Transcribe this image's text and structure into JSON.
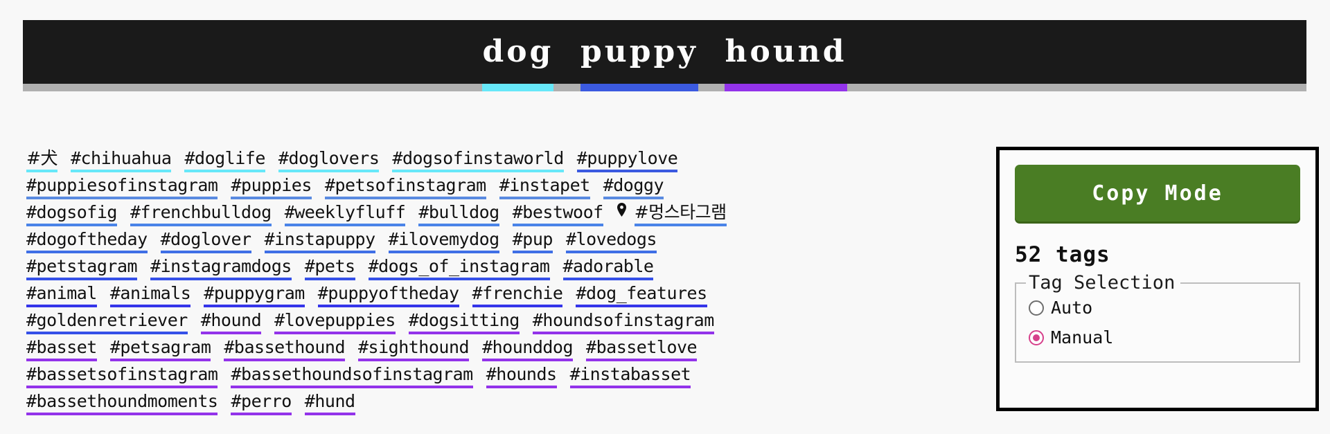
{
  "header": {
    "words": [
      {
        "text": "dog",
        "color": "#67e8f9"
      },
      {
        "text": "puppy",
        "color": "#3b5ae0"
      },
      {
        "text": "hound",
        "color": "#9333ea"
      }
    ],
    "separator": " ",
    "bar_bg": "#1a1a1a",
    "underbar_bg": "#b0b0b0"
  },
  "colors": {
    "dog": "#67e8f9",
    "puppy": "#3b5ae0",
    "hound": "#9333ea",
    "accent_green": "#4a7d24",
    "accent_pink": "#d6408b"
  },
  "tag_rows": [
    [
      {
        "label": "#犬",
        "color": "#67e8f9",
        "ko": true
      },
      {
        "label": "#chihuahua",
        "color": "#67e8f9"
      },
      {
        "label": "#doglife",
        "color": "#67e8f9"
      },
      {
        "label": "#doglovers",
        "color": "#67e8f9"
      },
      {
        "label": "#dogsofinstaworld",
        "color": "#67e8f9"
      },
      {
        "label": "#puppylove",
        "color": "#3b5ae0"
      }
    ],
    [
      {
        "label": "#puppiesofinstagram",
        "color": "#5a8ae0"
      },
      {
        "label": "#puppies",
        "color": "#5a8ae0"
      },
      {
        "label": "#petsofinstagram",
        "color": "#5a8ae0"
      },
      {
        "label": "#instapet",
        "color": "#5a8ae0"
      },
      {
        "label": "#doggy",
        "color": "#5a8ae0"
      }
    ],
    [
      {
        "label": "#dogsofig",
        "color": "#4a84e8"
      },
      {
        "label": "#frenchbulldog",
        "color": "#4a84e8"
      },
      {
        "label": "#weeklyfluff",
        "color": "#4a84e8"
      },
      {
        "label": "#bulldog",
        "color": "#4a84e8"
      },
      {
        "label": "#bestwoof",
        "color": "#4a84e8"
      },
      {
        "label": "#멍스타그램",
        "color": "#4a84e8",
        "ko": true,
        "icon": "location-pin-icon"
      }
    ],
    [
      {
        "label": "#dogoftheday",
        "color": "#3f6fe6"
      },
      {
        "label": "#doglover",
        "color": "#3f6fe6"
      },
      {
        "label": "#instapuppy",
        "color": "#3f6fe6"
      },
      {
        "label": "#ilovemydog",
        "color": "#3f6fe6"
      },
      {
        "label": "#pup",
        "color": "#3f6fe6"
      },
      {
        "label": "#lovedogs",
        "color": "#3f6fe6"
      }
    ],
    [
      {
        "label": "#petstagram",
        "color": "#3550e8"
      },
      {
        "label": "#instagramdogs",
        "color": "#3550e8"
      },
      {
        "label": "#pets",
        "color": "#3550e8"
      },
      {
        "label": "#dogs_of_instagram",
        "color": "#3550e8"
      },
      {
        "label": "#adorable",
        "color": "#3550e8"
      }
    ],
    [
      {
        "label": "#animal",
        "color": "#3535ea"
      },
      {
        "label": "#animals",
        "color": "#3535ea"
      },
      {
        "label": "#puppygram",
        "color": "#3535ea"
      },
      {
        "label": "#puppyoftheday",
        "color": "#3535ea"
      },
      {
        "label": "#frenchie",
        "color": "#3535ea"
      },
      {
        "label": "#dog_features",
        "color": "#3535ea"
      }
    ],
    [
      {
        "label": "#goldenretriever",
        "color": "#3550e8"
      },
      {
        "label": "#hound",
        "color": "#9333ea"
      },
      {
        "label": "#lovepuppies",
        "color": "#9333ea"
      },
      {
        "label": "#dogsitting",
        "color": "#9333ea"
      },
      {
        "label": "#houndsofinstagram",
        "color": "#9333ea"
      }
    ],
    [
      {
        "label": "#basset",
        "color": "#9333ea"
      },
      {
        "label": "#petsagram",
        "color": "#9333ea"
      },
      {
        "label": "#bassethound",
        "color": "#9333ea"
      },
      {
        "label": "#sighthound",
        "color": "#9333ea"
      },
      {
        "label": "#hounddog",
        "color": "#9333ea"
      },
      {
        "label": "#bassetlove",
        "color": "#9333ea"
      }
    ],
    [
      {
        "label": "#bassetsofinstagram",
        "color": "#9333ea"
      },
      {
        "label": "#bassethoundsofinstagram",
        "color": "#9333ea"
      },
      {
        "label": "#hounds",
        "color": "#9333ea"
      },
      {
        "label": "#instabasset",
        "color": "#9333ea"
      }
    ],
    [
      {
        "label": "#bassethoundmoments",
        "color": "#9333ea"
      },
      {
        "label": "#perro",
        "color": "#9333ea"
      },
      {
        "label": "#hund",
        "color": "#9333ea"
      }
    ]
  ],
  "panel": {
    "copy_button_label": "Copy Mode",
    "tag_count_label": "52 tags",
    "fieldset_legend": "Tag Selection",
    "options": [
      {
        "label": "Auto",
        "checked": false
      },
      {
        "label": "Manual",
        "checked": true
      }
    ]
  }
}
